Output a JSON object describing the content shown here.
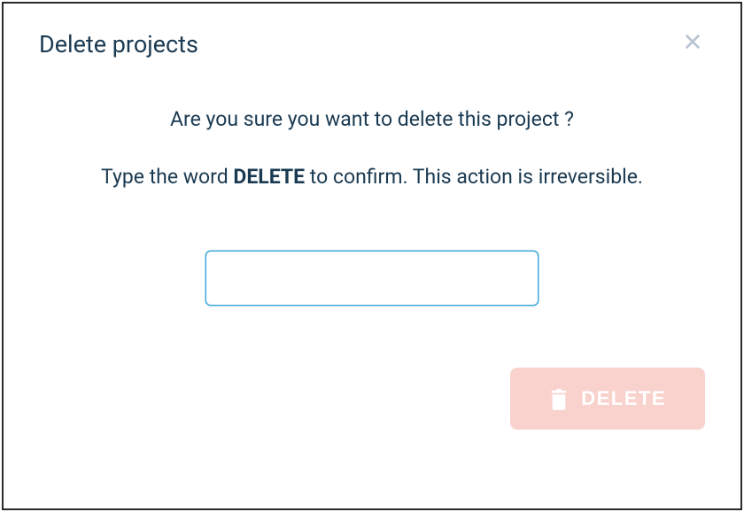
{
  "dialog": {
    "title": "Delete projects",
    "confirm_question": "Are you sure you want to delete this project ?",
    "instruction_prefix": "Type the word ",
    "instruction_keyword": "DELETE",
    "instruction_suffix": " to confirm. This action is irreversible.",
    "input_value": "",
    "delete_button_label": "DELETE"
  }
}
